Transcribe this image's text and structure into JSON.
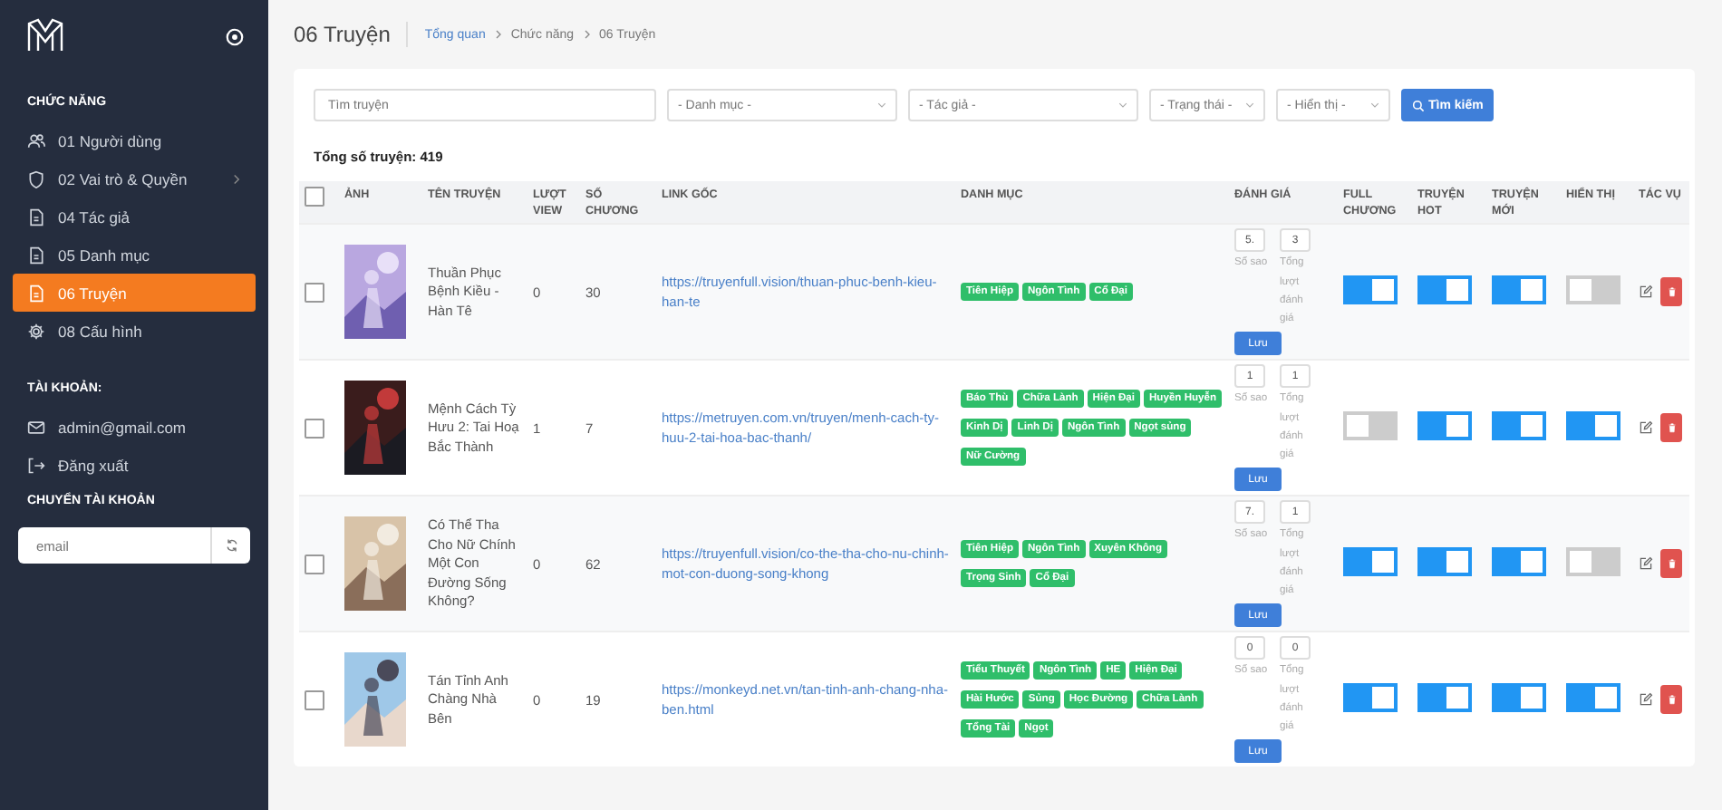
{
  "sidebar": {
    "sections": [
      {
        "title": "CHỨC NĂNG",
        "items": [
          {
            "label": "01 Người dùng",
            "selected": false,
            "submenu": false
          },
          {
            "label": "02 Vai trò & Quyền",
            "selected": false,
            "submenu": true
          },
          {
            "label": "04 Tác giả",
            "selected": false,
            "submenu": false
          },
          {
            "label": "05 Danh mục",
            "selected": false,
            "submenu": false
          },
          {
            "label": "06 Truyện",
            "selected": true,
            "submenu": false
          },
          {
            "label": "08 Cấu hình",
            "selected": false,
            "submenu": false
          }
        ]
      },
      {
        "title": "TÀI KHOẢN:",
        "items": [
          {
            "label": "admin@gmail.com",
            "selected": false,
            "submenu": false
          },
          {
            "label": "Đăng xuất",
            "selected": false,
            "submenu": false
          }
        ]
      }
    ],
    "switch_account": {
      "title": "CHUYỂN TÀI KHOẢN",
      "placeholder": "email"
    }
  },
  "page": {
    "title": "06 Truyện",
    "breadcrumb": [
      {
        "label": "Tổng quan",
        "link": true
      },
      {
        "label": "Chức năng",
        "link": false
      },
      {
        "label": "06 Truyện",
        "link": false
      }
    ]
  },
  "filters": {
    "search_placeholder": "Tìm truyện",
    "selects": [
      {
        "value": "- Danh mục -"
      },
      {
        "value": "- Tác giả -"
      },
      {
        "value": "- Trạng thái -"
      },
      {
        "value": "- Hiển thị -"
      }
    ],
    "button": "Tìm kiếm"
  },
  "total": "Tổng số truyện: 419",
  "table": {
    "select_all_checked": false,
    "columns": [
      "ẢNH",
      "TÊN TRUYỆN",
      "LƯỢT VIEW",
      "SỐ CHƯƠNG",
      "LINK GỐC",
      "DANH MỤC",
      "ĐÁNH GIÁ",
      "FULL CHƯƠNG",
      "TRUYỆN HOT",
      "TRUYỆN MỚI",
      "HIỂN THỊ",
      "TÁC VỤ"
    ],
    "rows": [
      {
        "checked": false,
        "title": "Thuần Phục Bệnh Kiều - Hàn Tê",
        "views": "0",
        "chapters": "30",
        "link": "https://truyenfull.vision/thuan-phuc-benh-kieu-han-te",
        "tags": [
          "Tiên Hiệp",
          "Ngôn Tình",
          "Cổ Đại"
        ],
        "stars_value": "5.",
        "rating_count": "3",
        "stars_label": "Số sao",
        "count_label": "Tổng lượt đánh giá",
        "save": "Lưu",
        "full": true,
        "hot": true,
        "new": true,
        "visible": false
      },
      {
        "checked": false,
        "title": "Mệnh Cách Tỳ Hưu 2: Tai Hoạ Bắc Thành",
        "views": "1",
        "chapters": "7",
        "link": "https://metruyen.com.vn/truyen/menh-cach-ty-huu-2-tai-hoa-bac-thanh/",
        "tags": [
          "Báo Thù",
          "Chữa Lành",
          "Hiện Đại",
          "Huyền Huyễn",
          "Kinh Dị",
          "Linh Dị",
          "Ngôn Tình",
          "Ngọt sủng",
          "Nữ Cường"
        ],
        "stars_value": "1",
        "rating_count": "1",
        "stars_label": "Số sao",
        "count_label": "Tổng lượt đánh giá",
        "save": "Lưu",
        "full": false,
        "hot": true,
        "new": true,
        "visible": true
      },
      {
        "checked": false,
        "title": "Có Thể Tha Cho Nữ Chính Một Con Đường Sống Không?",
        "views": "0",
        "chapters": "62",
        "link": "https://truyenfull.vision/co-the-tha-cho-nu-chinh-mot-con-duong-song-khong",
        "tags": [
          "Tiên Hiệp",
          "Ngôn Tình",
          "Xuyên Không",
          "Trọng Sinh",
          "Cổ Đại"
        ],
        "stars_value": "7.",
        "rating_count": "1",
        "stars_label": "Số sao",
        "count_label": "Tổng lượt đánh giá",
        "save": "Lưu",
        "full": true,
        "hot": true,
        "new": true,
        "visible": false
      },
      {
        "checked": false,
        "title": "Tán Tỉnh Anh Chàng Nhà Bên",
        "views": "0",
        "chapters": "19",
        "link": "https://monkeyd.net.vn/tan-tinh-anh-chang-nha-ben.html",
        "tags": [
          "Tiểu Thuyết",
          "Ngôn Tình",
          "HE",
          "Hiện Đại",
          "Hài Hước",
          "Sủng",
          "Học Đường",
          "Chữa Lành",
          "Tổng Tài",
          "Ngọt"
        ],
        "stars_value": "0",
        "rating_count": "0",
        "stars_label": "Số sao",
        "count_label": "Tổng lượt đánh giá",
        "save": "Lưu",
        "full": true,
        "hot": true,
        "new": true,
        "visible": true
      }
    ]
  }
}
